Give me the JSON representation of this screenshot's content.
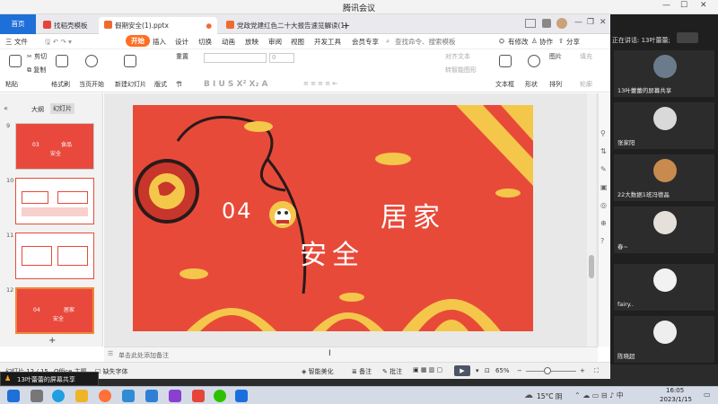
{
  "window": {
    "title": "腾讯会议"
  },
  "tabs": [
    {
      "label": "首页"
    },
    {
      "label": "找稻壳模板"
    },
    {
      "label": "假期安全(1).pptx"
    },
    {
      "label": "党政党建红色二十大报告速览解读(1)"
    },
    {
      "label": "+"
    }
  ],
  "menu": {
    "file": "三 文件",
    "items": [
      "开始",
      "插入",
      "设计",
      "切换",
      "动画",
      "放映",
      "审阅",
      "视图",
      "开发工具",
      "会员专享"
    ],
    "search": "查找命令、搜索模板",
    "modify": "有修改",
    "collab": "协作",
    "share": "分享"
  },
  "ribbon": {
    "paste": "粘贴",
    "cut": "剪切",
    "copy": "复制",
    "format_painter": "格式刷",
    "from_current": "当页开始",
    "new_slide": "新建幻灯片",
    "layout": "版式",
    "section": "节",
    "reset": "重置",
    "zero": "0",
    "align_text": "对齐文本",
    "smartart": "转智能图形",
    "textbox": "文本框",
    "shape": "形状",
    "picture": "图片",
    "fill": "填充",
    "arrange": "排列",
    "outline": "轮廓"
  },
  "panel": {
    "outline_tab": "大纲",
    "slides_tab": "幻灯片"
  },
  "thumbnails": [
    {
      "num": "9",
      "line1": "03",
      "line2": "食品",
      "line3": "安全"
    },
    {
      "num": "10",
      "line1": "",
      "line2": "",
      "line3": ""
    },
    {
      "num": "11",
      "line1": "",
      "line2": "",
      "line3": ""
    },
    {
      "num": "12",
      "line1": "04",
      "line2": "居家",
      "line3": "安全"
    }
  ],
  "slide": {
    "number": "04",
    "title1": "居家",
    "title2": "安全"
  },
  "notes": {
    "placeholder": "单击此处添加备注"
  },
  "status": {
    "slide": "幻灯片 12 / 15",
    "theme": "Office 主题",
    "missing_font": "缺失字体",
    "beautify": "智能美化",
    "notes": "备注",
    "comments": "批注",
    "zoom": "65%"
  },
  "meeting": {
    "speaking": "正在讲话: 13叶蕾蕾;",
    "participants": [
      {
        "name": "13叶蕾蕾的屏幕共享",
        "color": "#6a7c8c"
      },
      {
        "name": "张家阳",
        "color": "#d9d9d9"
      },
      {
        "name": "22大数据1班冯德晶",
        "color": "#c88a4e"
      },
      {
        "name": "春~",
        "color": "#e6e0da"
      },
      {
        "name": "fairy..",
        "color": "#f2f2f2"
      },
      {
        "name": "陈晓超",
        "color": "#eeeeee"
      }
    ]
  },
  "share_bar": {
    "label": "13叶蕾蕾的屏幕共享"
  },
  "taskbar": {
    "weather": "15°C 阴",
    "time": "16:05",
    "date": "2023/1/15"
  }
}
